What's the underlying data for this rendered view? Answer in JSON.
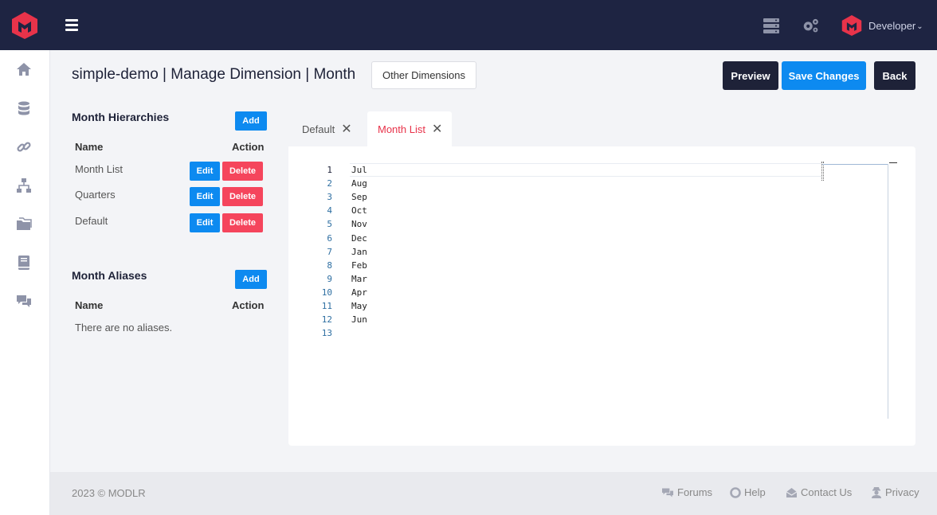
{
  "topbar": {
    "user_name": "Developer",
    "chevron": "⌄",
    "icons": [
      "logo-icon",
      "hamburger-icon",
      "server-icon",
      "gears-icon",
      "user-logo-icon"
    ]
  },
  "sidebar": {
    "icons": [
      "home-icon",
      "database-icon",
      "link-icon",
      "sitemap-icon",
      "folders-icon",
      "book-icon",
      "comments-icon"
    ]
  },
  "header": {
    "title": "simple-demo | Manage Dimension | Month",
    "other_dimensions": "Other Dimensions",
    "preview": "Preview",
    "save_changes": "Save Changes",
    "back": "Back"
  },
  "hierarchies": {
    "title": "Month Hierarchies",
    "add": "Add",
    "col_name": "Name",
    "col_action": "Action",
    "rows": [
      {
        "name": "Month List",
        "edit": "Edit",
        "delete": "Delete"
      },
      {
        "name": "Quarters",
        "edit": "Edit",
        "delete": "Delete"
      },
      {
        "name": "Default",
        "edit": "Edit",
        "delete": "Delete"
      }
    ]
  },
  "aliases": {
    "title": "Month Aliases",
    "add": "Add",
    "col_name": "Name",
    "col_action": "Action",
    "empty": "There are no aliases."
  },
  "tabs": [
    {
      "label": "Default",
      "close": "✕",
      "active": false
    },
    {
      "label": "Month List",
      "close": "✕",
      "active": true
    }
  ],
  "editor": {
    "line_numbers": [
      "1",
      "2",
      "3",
      "4",
      "5",
      "6",
      "7",
      "8",
      "9",
      "10",
      "11",
      "12",
      "13"
    ],
    "lines": [
      "Jul",
      "Aug",
      "Sep",
      "Oct",
      "Nov",
      "Dec",
      "Jan",
      "Feb",
      "Mar",
      "Apr",
      "May",
      "Jun",
      ""
    ]
  },
  "footer": {
    "copyright": "2023 © MODLR",
    "forums": "Forums",
    "help": "Help",
    "contact": "Contact Us",
    "privacy": "Privacy"
  },
  "colors": {
    "topbar": "#1e2442",
    "brand_red": "#e8334a",
    "primary_blue": "#0d8af0",
    "danger_red": "#f5455c",
    "dark_button": "#1e2238"
  }
}
